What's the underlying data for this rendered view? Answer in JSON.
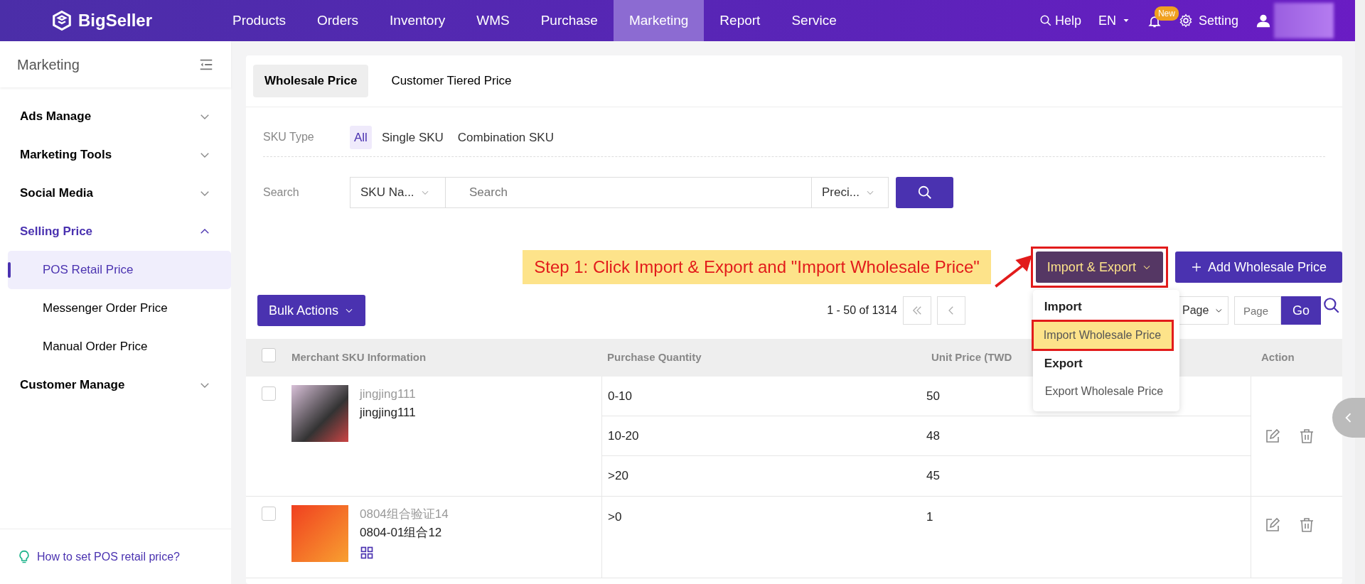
{
  "navbar": {
    "brand": "BigSeller",
    "menu": [
      {
        "label": "Products",
        "selected": false
      },
      {
        "label": "Orders",
        "selected": false
      },
      {
        "label": "Inventory",
        "selected": false
      },
      {
        "label": "WMS",
        "selected": false
      },
      {
        "label": "Purchase",
        "selected": false
      },
      {
        "label": "Marketing",
        "selected": true
      },
      {
        "label": "Report",
        "selected": false
      },
      {
        "label": "Service",
        "selected": false
      }
    ],
    "help": "Help",
    "language": "EN",
    "notification_badge": "New",
    "setting": "Setting"
  },
  "sidebar": {
    "title": "Marketing",
    "groups": [
      {
        "label": "Ads Manage",
        "expanded": false,
        "selected": false
      },
      {
        "label": "Marketing Tools",
        "expanded": false,
        "selected": false
      },
      {
        "label": "Social Media",
        "expanded": false,
        "selected": false
      },
      {
        "label": "Selling Price",
        "expanded": true,
        "selected": true,
        "children": [
          {
            "label": "POS Retail Price",
            "selected": true
          },
          {
            "label": "Messenger Order Price",
            "selected": false
          },
          {
            "label": "Manual Order Price",
            "selected": false
          }
        ]
      },
      {
        "label": "Customer Manage",
        "expanded": false,
        "selected": false
      }
    ],
    "help_link": "How to set POS retail price?"
  },
  "tabs": [
    {
      "label": "Wholesale Price",
      "selected": true
    },
    {
      "label": "Customer Tiered Price",
      "selected": false
    }
  ],
  "sku_type": {
    "label": "SKU Type",
    "options": [
      {
        "label": "All",
        "selected": true
      },
      {
        "label": "Single SKU",
        "selected": false
      },
      {
        "label": "Combination SKU",
        "selected": false
      }
    ]
  },
  "search": {
    "label": "Search",
    "field_select": "SKU Na...",
    "placeholder": "Search",
    "match_select": "Preci..."
  },
  "annotation": {
    "text": "Step 1: Click Import & Export and \"Import Wholesale Price\""
  },
  "import_export": {
    "label": "Import & Export",
    "highlighted": true,
    "menu": [
      {
        "kind": "header",
        "label": "Import"
      },
      {
        "kind": "item",
        "label": "Import Wholesale Price",
        "highlighted": true
      },
      {
        "kind": "header",
        "label": "Export"
      },
      {
        "kind": "item",
        "label": "Export Wholesale Price",
        "highlighted": false
      }
    ]
  },
  "add_button": "Add Wholesale Price",
  "bulk_actions": "Bulk Actions",
  "pagination": {
    "summary": "1 - 50 of 1314",
    "per_page": "Page",
    "page_placeholder": "Page",
    "go": "Go"
  },
  "table": {
    "select_all_checked": false,
    "columns": [
      "Merchant SKU Information",
      "Purchase Quantity",
      "Unit Price (TWD",
      "Action"
    ],
    "rows": [
      {
        "checked": false,
        "sku_name": "jingjing111",
        "sku": "jingjing111",
        "combination": false,
        "tiers": [
          {
            "quantity": "0-10",
            "price": "50"
          },
          {
            "quantity": "10-20",
            "price": "48"
          },
          {
            "quantity": ">20",
            "price": "45"
          }
        ]
      },
      {
        "checked": false,
        "sku_name": "0804组合验证14",
        "sku": "0804-01组合12",
        "combination": true,
        "tiers": [
          {
            "quantity": ">0",
            "price": "1"
          }
        ]
      }
    ]
  }
}
